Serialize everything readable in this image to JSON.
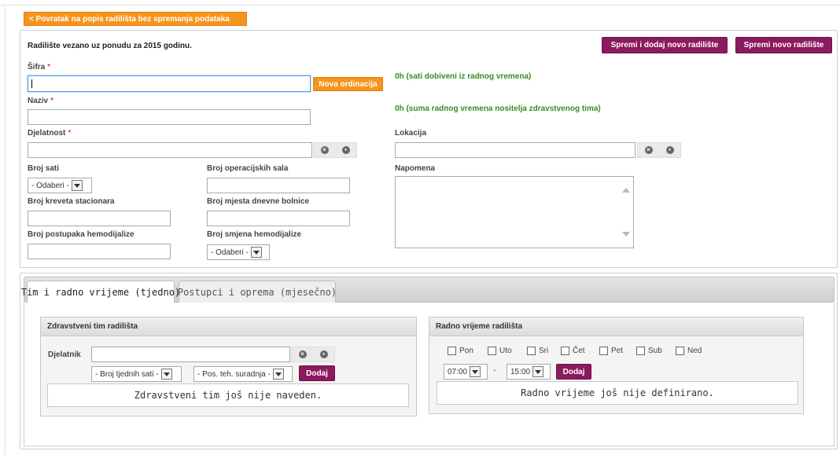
{
  "back_button": "< Povratak na popis radilišta bez spremanja podataka",
  "form": {
    "heading": "Radilište vezano uz ponudu za 2015 godinu.",
    "save_add_button": "Spremi i dodaj novo radilište",
    "save_new_button": "Spremi novo radilište",
    "sifra_label": "Šifra",
    "nova_ordinacija_button": "Nova ordinacija",
    "naziv_label": "Naziv",
    "djelatnost_label": "Djelatnost",
    "required_mark": "*",
    "hours_from_work_time": "0h (sati dobiveni iz radnog vremena)",
    "hours_team_sum": "0h (suma radnog vremena nositelja zdravstvenog tima)",
    "lokacija_label": "Lokacija",
    "broj_sati_label": "Broj sati",
    "broj_sati_value": "- Odaberi -",
    "broj_operacijskih_sala_label": "Broj operacijskih sala",
    "broj_kreveta_label": "Broj kreveta stacionara",
    "broj_mjesta_label": "Broj mjesta dnevne bolnice",
    "broj_postupaka_label": "Broj postupaka hemodijalize",
    "broj_smjena_label": "Broj smjena hemodijalize",
    "broj_smjena_value": "- Odaberi -",
    "napomena_label": "Napomena"
  },
  "tabs": [
    {
      "label": "Tim i radno vrijeme (tjedno)",
      "active": true
    },
    {
      "label": "Postupci i oprema (mjesečno)",
      "active": false
    }
  ],
  "team_panel": {
    "title": "Zdravstveni tim radilišta",
    "djelatnik_label": "Djelatnik",
    "hours_select": "- Broj tjednih sati -",
    "role_select": "- Pos. teh. suradnja -",
    "add_button": "Dodaj",
    "empty_text": "Zdravstveni tim još nije naveden."
  },
  "hours_panel": {
    "title": "Radno vrijeme radilišta",
    "days": [
      "Pon",
      "Uto",
      "Sri",
      "Čet",
      "Pet",
      "Sub",
      "Ned"
    ],
    "from_time": "07:00",
    "separator": "-",
    "to_time": "15:00",
    "add_button": "Dodaj",
    "empty_text": "Radno vrijeme još nije definirano."
  },
  "icons": {
    "clear": "clear-icon",
    "search": "search-icon"
  },
  "colors": {
    "orange": "#f7941d",
    "purple": "#8b1a5e",
    "green_text": "#3a8a1e",
    "required": "#cc0000"
  }
}
